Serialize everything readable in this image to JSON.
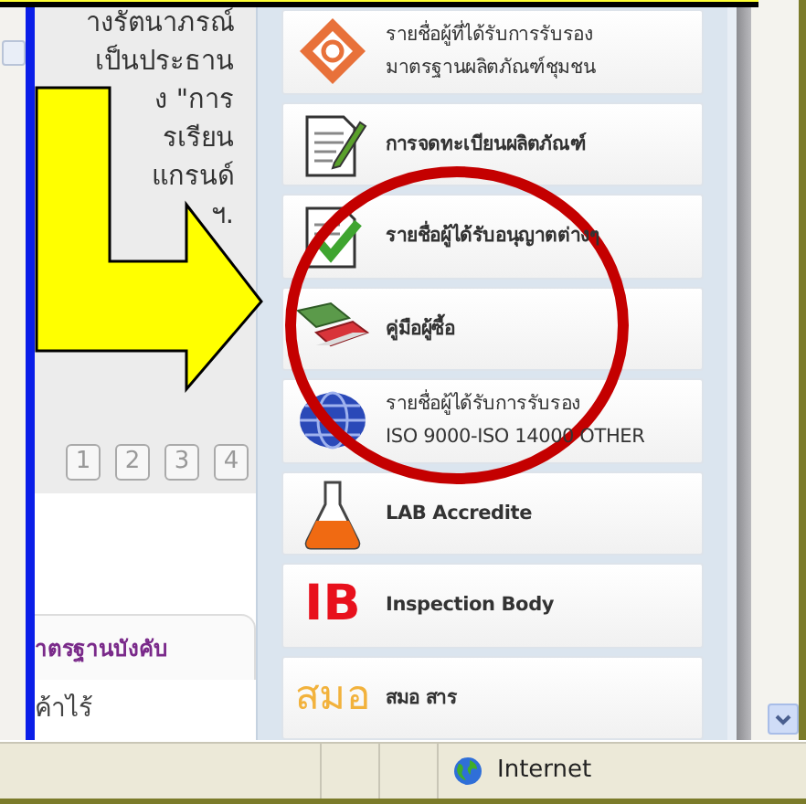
{
  "left_panel": {
    "text_lines": [
      "างรัตนาภรณ์",
      "เป็นประธาน",
      "ง \"การ",
      "รเรียน",
      "แกรนด์",
      "ฯ."
    ],
    "pages": [
      {
        "label": "1"
      },
      {
        "label": "2"
      },
      {
        "label": "3"
      },
      {
        "label": "4"
      }
    ],
    "tab": {
      "label": "าตรฐานบังคับ"
    },
    "tab_text": "ค้าไร้"
  },
  "menu": [
    {
      "kind": "emblem",
      "lines": [
        "รายชื่อผู้ที่ได้รับการรับรอง",
        "มาตรฐานผลิตภัณฑ์ชุมชน"
      ]
    },
    {
      "kind": "edit",
      "lines": [
        "การจดทะเบียนผลิตภัณฑ์"
      ]
    },
    {
      "kind": "check",
      "lines": [
        "รายชื่อผู้ได้รับอนุญาตต่างๆ"
      ]
    },
    {
      "kind": "books",
      "lines": [
        "คู่มือผู้ซื้อ"
      ]
    },
    {
      "kind": "globe",
      "lines": [
        "รายชื่อผู้ได้รับการรับรอง",
        "ISO 9000-ISO 14000 OTHER"
      ]
    },
    {
      "kind": "flask",
      "lines": [
        "LAB Accredite"
      ]
    },
    {
      "kind": "ib",
      "logo": "IB",
      "lines": [
        "Inspection Body"
      ]
    },
    {
      "kind": "tisi",
      "logo": "สมอ",
      "lines": [
        "สมอ สาร"
      ]
    }
  ],
  "status_bar": {
    "zone": "Internet"
  }
}
